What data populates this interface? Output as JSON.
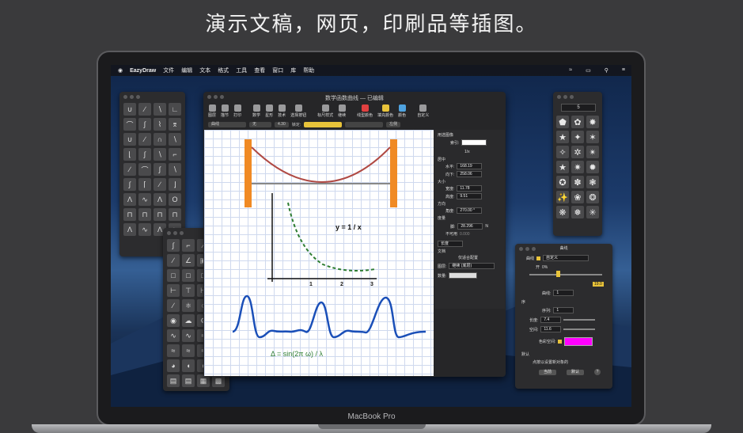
{
  "headline": "演示文稿，网页，印刷品等插图。",
  "brand": "MacBook Pro",
  "menubar": {
    "apple": "",
    "items": [
      "EazyDraw",
      "文件",
      "编辑",
      "文本",
      "格式",
      "工具",
      "查看",
      "窗口",
      "库",
      "帮助"
    ]
  },
  "document": {
    "title": "数学函数曲线 — 已编辑",
    "toolbar": [
      "图层",
      "描节",
      "打印",
      "数学",
      "星形",
      "技术",
      "选择按钮",
      "标尺样式",
      "继续",
      "线型颜色",
      "填充颜色",
      "颜色",
      "自定义"
    ],
    "format": {
      "line_style": "曲线",
      "fill": "无",
      "width": "4.30",
      "lock_label": "锁定:",
      "direction": "左侧"
    },
    "canvas": {
      "function_label": "y = 1 / x",
      "x_ticks": [
        "1",
        "2",
        "3"
      ],
      "formula": "Δ = sin(2π ω) / λ"
    },
    "inspector": {
      "heading": "用选图像",
      "index_label": "索引:",
      "subtitle": "1/x",
      "middle_label": "居中",
      "horiz_label": "水平:",
      "horiz_value": "168.19",
      "vert_label": "向下:",
      "vert_value": "258.06",
      "size_label": "大小",
      "width_label": "宽度:",
      "width_value": "11.78",
      "height_label": "高度:",
      "height_value": "9.51",
      "direction_label": "方向",
      "angle_label": "角度:",
      "angle_value": "270.00 °",
      "amount_label": "度量",
      "diameter_label": "脚:",
      "diameter_value": "28.296",
      "diameter_unit": "N",
      "unavailable_label": "不可用",
      "unavailable_value": "0.000",
      "length_label": "长度",
      "text_label": "文档",
      "fit_label": "仅适合配置",
      "layer_label": "图层:",
      "layer_value": "继续 (底层)",
      "count_label": "数量:"
    }
  },
  "curve_panel": {
    "title": "曲线",
    "curve_label": "曲线",
    "curve_value": "自定义",
    "open_label": "开",
    "open_value": "0%",
    "scale_value": "19.0",
    "curve_count_label": "曲线:",
    "curve_count_value": "1",
    "sequence_label": "序",
    "sequence_no_label": "序列:",
    "sequence_no_value": "1",
    "length_label": "长度:",
    "length_value": "7.4",
    "space_label": "空间:",
    "space_value": "11.6",
    "color_space_label": "色彩空间:",
    "default_label": "默认",
    "desc": "点按以设置新对象的",
    "current_button": "当前",
    "default_button": "默认",
    "help": "?"
  },
  "stars_panel": {
    "count": "5"
  },
  "colors": {
    "accent": "#e8c33a",
    "magenta": "#ff00ff",
    "pillar": "#f08a24",
    "curve_red": "#b04a44",
    "wave_blue": "#1a4fb8",
    "dash_green": "#2e7d32"
  }
}
